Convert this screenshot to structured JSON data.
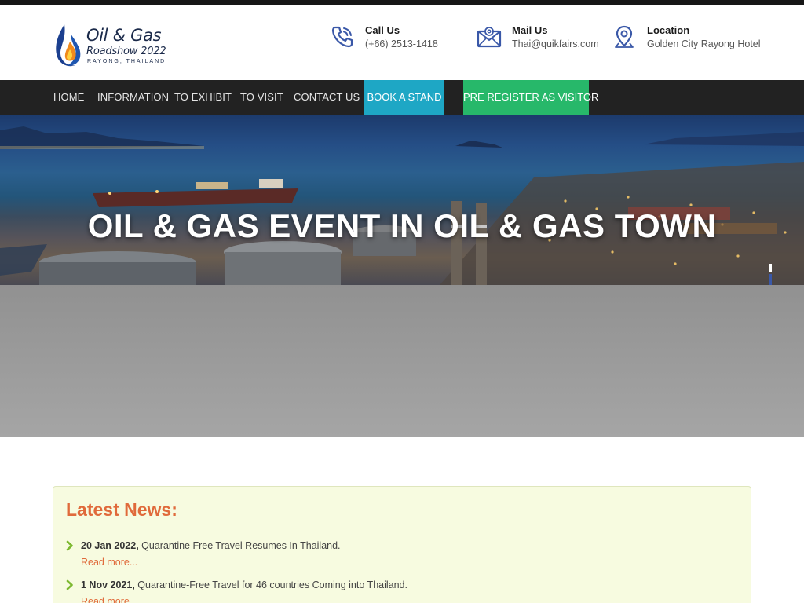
{
  "brand": {
    "title": "Oil & Gas",
    "subtitle": "Roadshow 2022",
    "location": "RAYONG, THAILAND"
  },
  "contacts": {
    "call": {
      "label": "Call Us",
      "value": "(+66) 2513-1418",
      "icon": "phone-icon"
    },
    "mail": {
      "label": "Mail Us",
      "value": "Thai@quikfairs.com",
      "icon": "mail-icon"
    },
    "location": {
      "label": "Location",
      "value": "Golden City Rayong Hotel",
      "icon": "location-pin-icon"
    }
  },
  "nav": {
    "items": [
      "HOME",
      "INFORMATION",
      "TO EXHIBIT",
      "TO VISIT",
      "CONTACT US"
    ],
    "book": "BOOK A STAND",
    "register": "PRE REGISTER AS VISITOR"
  },
  "hero": {
    "title": "OIL & GAS EVENT IN OIL & GAS TOWN"
  },
  "news": {
    "heading": "Latest News:",
    "items": [
      {
        "date": "20 Jan 2022,",
        "text": "Quarantine Free Travel Resumes In Thailand.",
        "more": "Read more..."
      },
      {
        "date": "1 Nov 2021,",
        "text": "Quarantine-Free Travel for 46 countries Coming into Thailand.",
        "more": "Read more..."
      }
    ]
  },
  "colors": {
    "nav_bg": "#222222",
    "book_btn": "#1ea7c5",
    "register_btn": "#27b86a",
    "accent": "#e06a3b",
    "news_bg": "#f7fbe0",
    "icon_blue": "#3a58a8"
  }
}
